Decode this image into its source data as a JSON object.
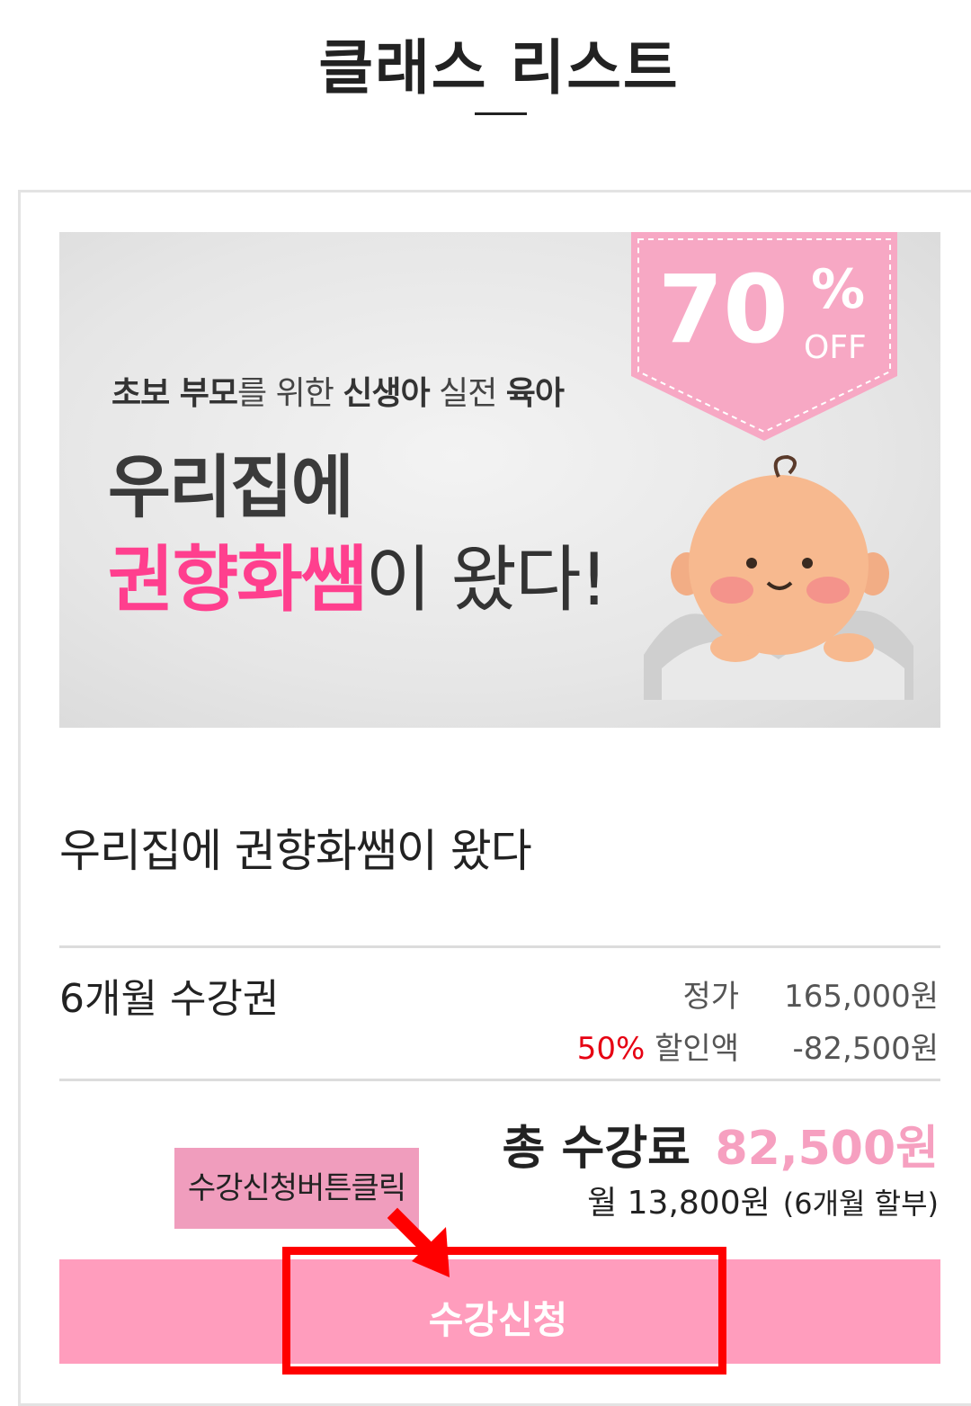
{
  "page": {
    "title": "클래스 리스트"
  },
  "banner": {
    "subtitle_parts": [
      "초보 부모",
      "를 위한 ",
      "신생아",
      " 실전 ",
      "육아"
    ],
    "headline_line1": "우리집에",
    "headline_pink": "권향화쌤",
    "headline_rest": "이 왔다!",
    "discount_number": "70",
    "discount_percent": "%",
    "discount_off": "OFF"
  },
  "class": {
    "name": "우리집에 권향화쌤이 왔다",
    "ticket": "6개월 수강권",
    "regular_price_label": "정가",
    "regular_price": "165,000원",
    "discount_percent": "50%",
    "discount_label": "할인액",
    "discount_amount": "-82,500원",
    "total_label": "총 수강료",
    "total_price": "82,500원",
    "monthly_price": "월 13,800원",
    "installment": "(6개월 할부)",
    "apply_button": "수강신청"
  },
  "annotation": {
    "callout_text": "수강신청버튼클릭"
  },
  "colors": {
    "brand_pink": "#ff9dbd",
    "headline_pink": "#ff3f8e",
    "price_pink": "#f6a0c0",
    "discount_red": "#e60012",
    "highlight_red": "#ff0000"
  }
}
